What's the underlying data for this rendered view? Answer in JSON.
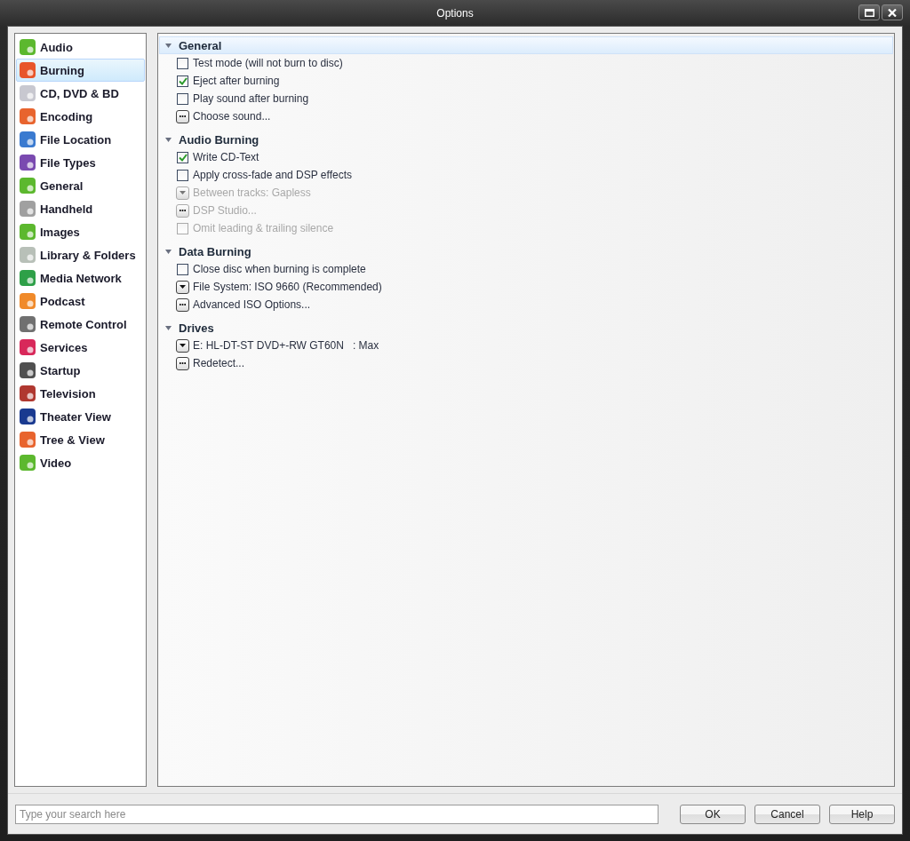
{
  "window": {
    "title": "Options"
  },
  "sidebar": {
    "items": [
      {
        "label": "Audio",
        "selected": false,
        "color": "#5cb82e"
      },
      {
        "label": "Burning",
        "selected": true,
        "color": "#e8552a"
      },
      {
        "label": "CD, DVD & BD",
        "selected": false,
        "color": "#c8c8d0"
      },
      {
        "label": "Encoding",
        "selected": false,
        "color": "#e8642e"
      },
      {
        "label": "File Location",
        "selected": false,
        "color": "#3a7ad0"
      },
      {
        "label": "File Types",
        "selected": false,
        "color": "#7a4ab0"
      },
      {
        "label": "General",
        "selected": false,
        "color": "#5cb82e"
      },
      {
        "label": "Handheld",
        "selected": false,
        "color": "#a0a0a0"
      },
      {
        "label": "Images",
        "selected": false,
        "color": "#5cb82e"
      },
      {
        "label": "Library & Folders",
        "selected": false,
        "color": "#b8c0b8"
      },
      {
        "label": "Media Network",
        "selected": false,
        "color": "#2ea048"
      },
      {
        "label": "Podcast",
        "selected": false,
        "color": "#f08a2a"
      },
      {
        "label": "Remote Control",
        "selected": false,
        "color": "#707070"
      },
      {
        "label": "Services",
        "selected": false,
        "color": "#d8285a"
      },
      {
        "label": "Startup",
        "selected": false,
        "color": "#505050"
      },
      {
        "label": "Television",
        "selected": false,
        "color": "#b03830"
      },
      {
        "label": "Theater View",
        "selected": false,
        "color": "#1a3a90"
      },
      {
        "label": "Tree & View",
        "selected": false,
        "color": "#e8642e"
      },
      {
        "label": "Video",
        "selected": false,
        "color": "#5cb82e"
      }
    ]
  },
  "sections": [
    {
      "title": "General",
      "expanded": true,
      "selected": true,
      "items": [
        {
          "kind": "checkbox",
          "label": "Test mode (will not burn to disc)",
          "checked": false,
          "disabled": false
        },
        {
          "kind": "checkbox",
          "label": "Eject after burning",
          "checked": true,
          "disabled": false
        },
        {
          "kind": "checkbox",
          "label": "Play sound after burning",
          "checked": false,
          "disabled": false
        },
        {
          "kind": "button",
          "label": "Choose sound...",
          "disabled": false
        }
      ]
    },
    {
      "title": "Audio Burning",
      "expanded": true,
      "selected": false,
      "items": [
        {
          "kind": "checkbox",
          "label": "Write CD-Text",
          "checked": true,
          "disabled": false
        },
        {
          "kind": "checkbox",
          "label": "Apply cross-fade and DSP effects",
          "checked": false,
          "disabled": false
        },
        {
          "kind": "dropdown",
          "label": "Between tracks: Gapless",
          "disabled": true
        },
        {
          "kind": "button",
          "label": "DSP Studio...",
          "disabled": true
        },
        {
          "kind": "checkbox",
          "label": "Omit leading & trailing silence",
          "checked": false,
          "disabled": true
        }
      ]
    },
    {
      "title": "Data Burning",
      "expanded": true,
      "selected": false,
      "items": [
        {
          "kind": "checkbox",
          "label": "Close disc when burning is complete",
          "checked": false,
          "disabled": false
        },
        {
          "kind": "dropdown",
          "label": "File System: ISO 9660 (Recommended)",
          "disabled": false
        },
        {
          "kind": "button",
          "label": "Advanced ISO Options...",
          "disabled": false
        }
      ]
    },
    {
      "title": "Drives",
      "expanded": true,
      "selected": false,
      "items": [
        {
          "kind": "dropdown",
          "label": "E: HL-DT-ST DVD+-RW GT60N   : Max",
          "disabled": false
        },
        {
          "kind": "button",
          "label": "Redetect...",
          "disabled": false
        }
      ]
    }
  ],
  "footer": {
    "search": {
      "placeholder": "Type your search here"
    },
    "buttons": [
      "OK",
      "Cancel",
      "Help"
    ]
  }
}
